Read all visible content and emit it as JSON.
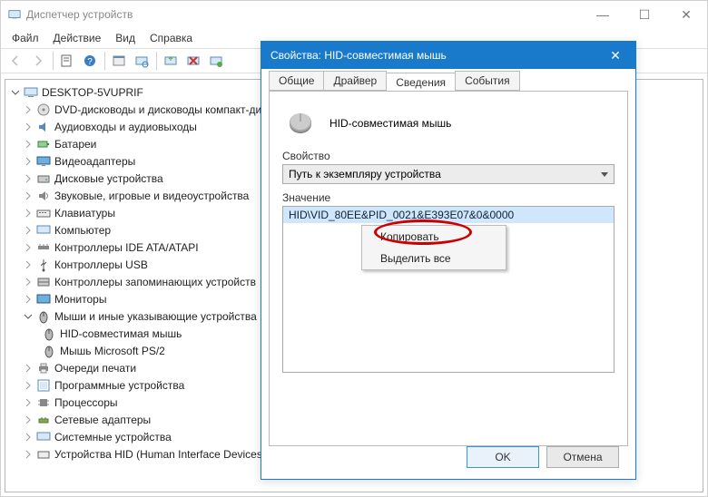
{
  "main": {
    "title": "Диспетчер устройств",
    "menus": [
      "Файл",
      "Действие",
      "Вид",
      "Справка"
    ],
    "tree": {
      "root": "DESKTOP-5VUPRIF",
      "items": [
        {
          "label": "DVD-дисководы и дисководы компакт-дисков"
        },
        {
          "label": "Аудиовходы и аудиовыходы"
        },
        {
          "label": "Батареи"
        },
        {
          "label": "Видеоадаптеры"
        },
        {
          "label": "Дисковые устройства"
        },
        {
          "label": "Звуковые, игровые и видеоустройства"
        },
        {
          "label": "Клавиатуры"
        },
        {
          "label": "Компьютер"
        },
        {
          "label": "Контроллеры IDE ATA/ATAPI"
        },
        {
          "label": "Контроллеры USB"
        },
        {
          "label": "Контроллеры запоминающих устройств"
        },
        {
          "label": "Мониторы"
        },
        {
          "label": "Мыши и иные указывающие устройства",
          "expanded": true,
          "children": [
            {
              "label": "HID-совместимая мышь"
            },
            {
              "label": "Мышь Microsoft PS/2"
            }
          ]
        },
        {
          "label": "Очереди печати"
        },
        {
          "label": "Программные устройства"
        },
        {
          "label": "Процессоры"
        },
        {
          "label": "Сетевые адаптеры"
        },
        {
          "label": "Системные устройства"
        },
        {
          "label": "Устройства HID (Human Interface Devices)"
        }
      ]
    }
  },
  "dialog": {
    "title": "Свойства: HID-совместимая мышь",
    "tabs": [
      "Общие",
      "Драйвер",
      "Сведения",
      "События"
    ],
    "active_tab": 2,
    "device_name": "HID-совместимая мышь",
    "property_label": "Свойство",
    "combo_value": "Путь к экземпляру устройства",
    "value_label": "Значение",
    "value_text": "HID\\VID_80EE&PID_0021&E393E07&0&0000",
    "context_menu": [
      "Копировать",
      "Выделить все"
    ],
    "ok": "OK",
    "cancel": "Отмена"
  }
}
